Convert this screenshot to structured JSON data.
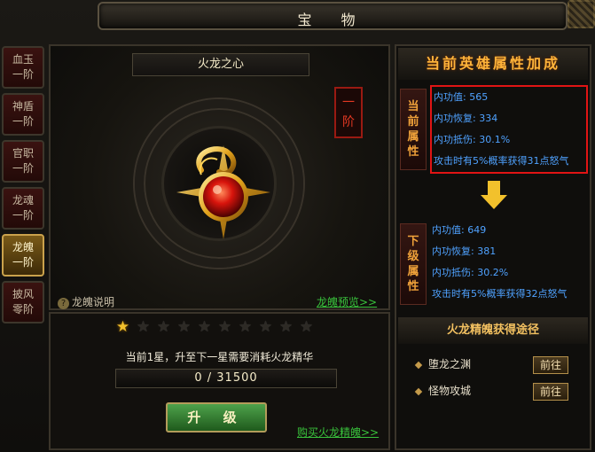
{
  "window": {
    "title": "宝 物"
  },
  "tabs": [
    {
      "line1": "血玉",
      "line2": "一阶",
      "active": false
    },
    {
      "line1": "神盾",
      "line2": "一阶",
      "active": false
    },
    {
      "line1": "官职",
      "line2": "一阶",
      "active": false
    },
    {
      "line1": "龙魂",
      "line2": "一阶",
      "active": false
    },
    {
      "line1": "龙魄",
      "line2": "一阶",
      "active": true
    },
    {
      "line1": "披风",
      "line2": "零阶",
      "active": false
    }
  ],
  "item": {
    "name": "火龙之心",
    "rank_line1": "一",
    "rank_line2": "阶",
    "help_label": "龙魄说明",
    "preview_link": "龙魄预览>>"
  },
  "stars": {
    "lit": 1,
    "total": 10
  },
  "upgrade": {
    "info": "当前1星，升至下一星需要消耗火龙精华",
    "progress_text": "0 / 31500",
    "current": 0,
    "required": 31500,
    "button_label": "升 级",
    "buy_link": "购买火龙精魄>>"
  },
  "attributes": {
    "header": "当前英雄属性加成",
    "current": {
      "label": [
        "当",
        "前",
        "属",
        "性"
      ],
      "lines": [
        "内功值: 565",
        "内功恢复: 334",
        "内功抵伤: 30.1%",
        "攻击时有5%概率获得31点怒气"
      ]
    },
    "next": {
      "label": [
        "下",
        "级",
        "属",
        "性"
      ],
      "lines": [
        "内功值: 649",
        "内功恢复: 381",
        "内功抵伤: 30.2%",
        "攻击时有5%概率获得32点怒气"
      ]
    }
  },
  "sources": {
    "title": "火龙精魄获得途径",
    "items": [
      {
        "name": "堕龙之渊",
        "button": "前往"
      },
      {
        "name": "怪物攻城",
        "button": "前往"
      }
    ]
  },
  "colors": {
    "attr_text": "#4fa2ff",
    "link": "#39c23c",
    "highlight": "#e01414",
    "gold": "#f2c02c"
  }
}
